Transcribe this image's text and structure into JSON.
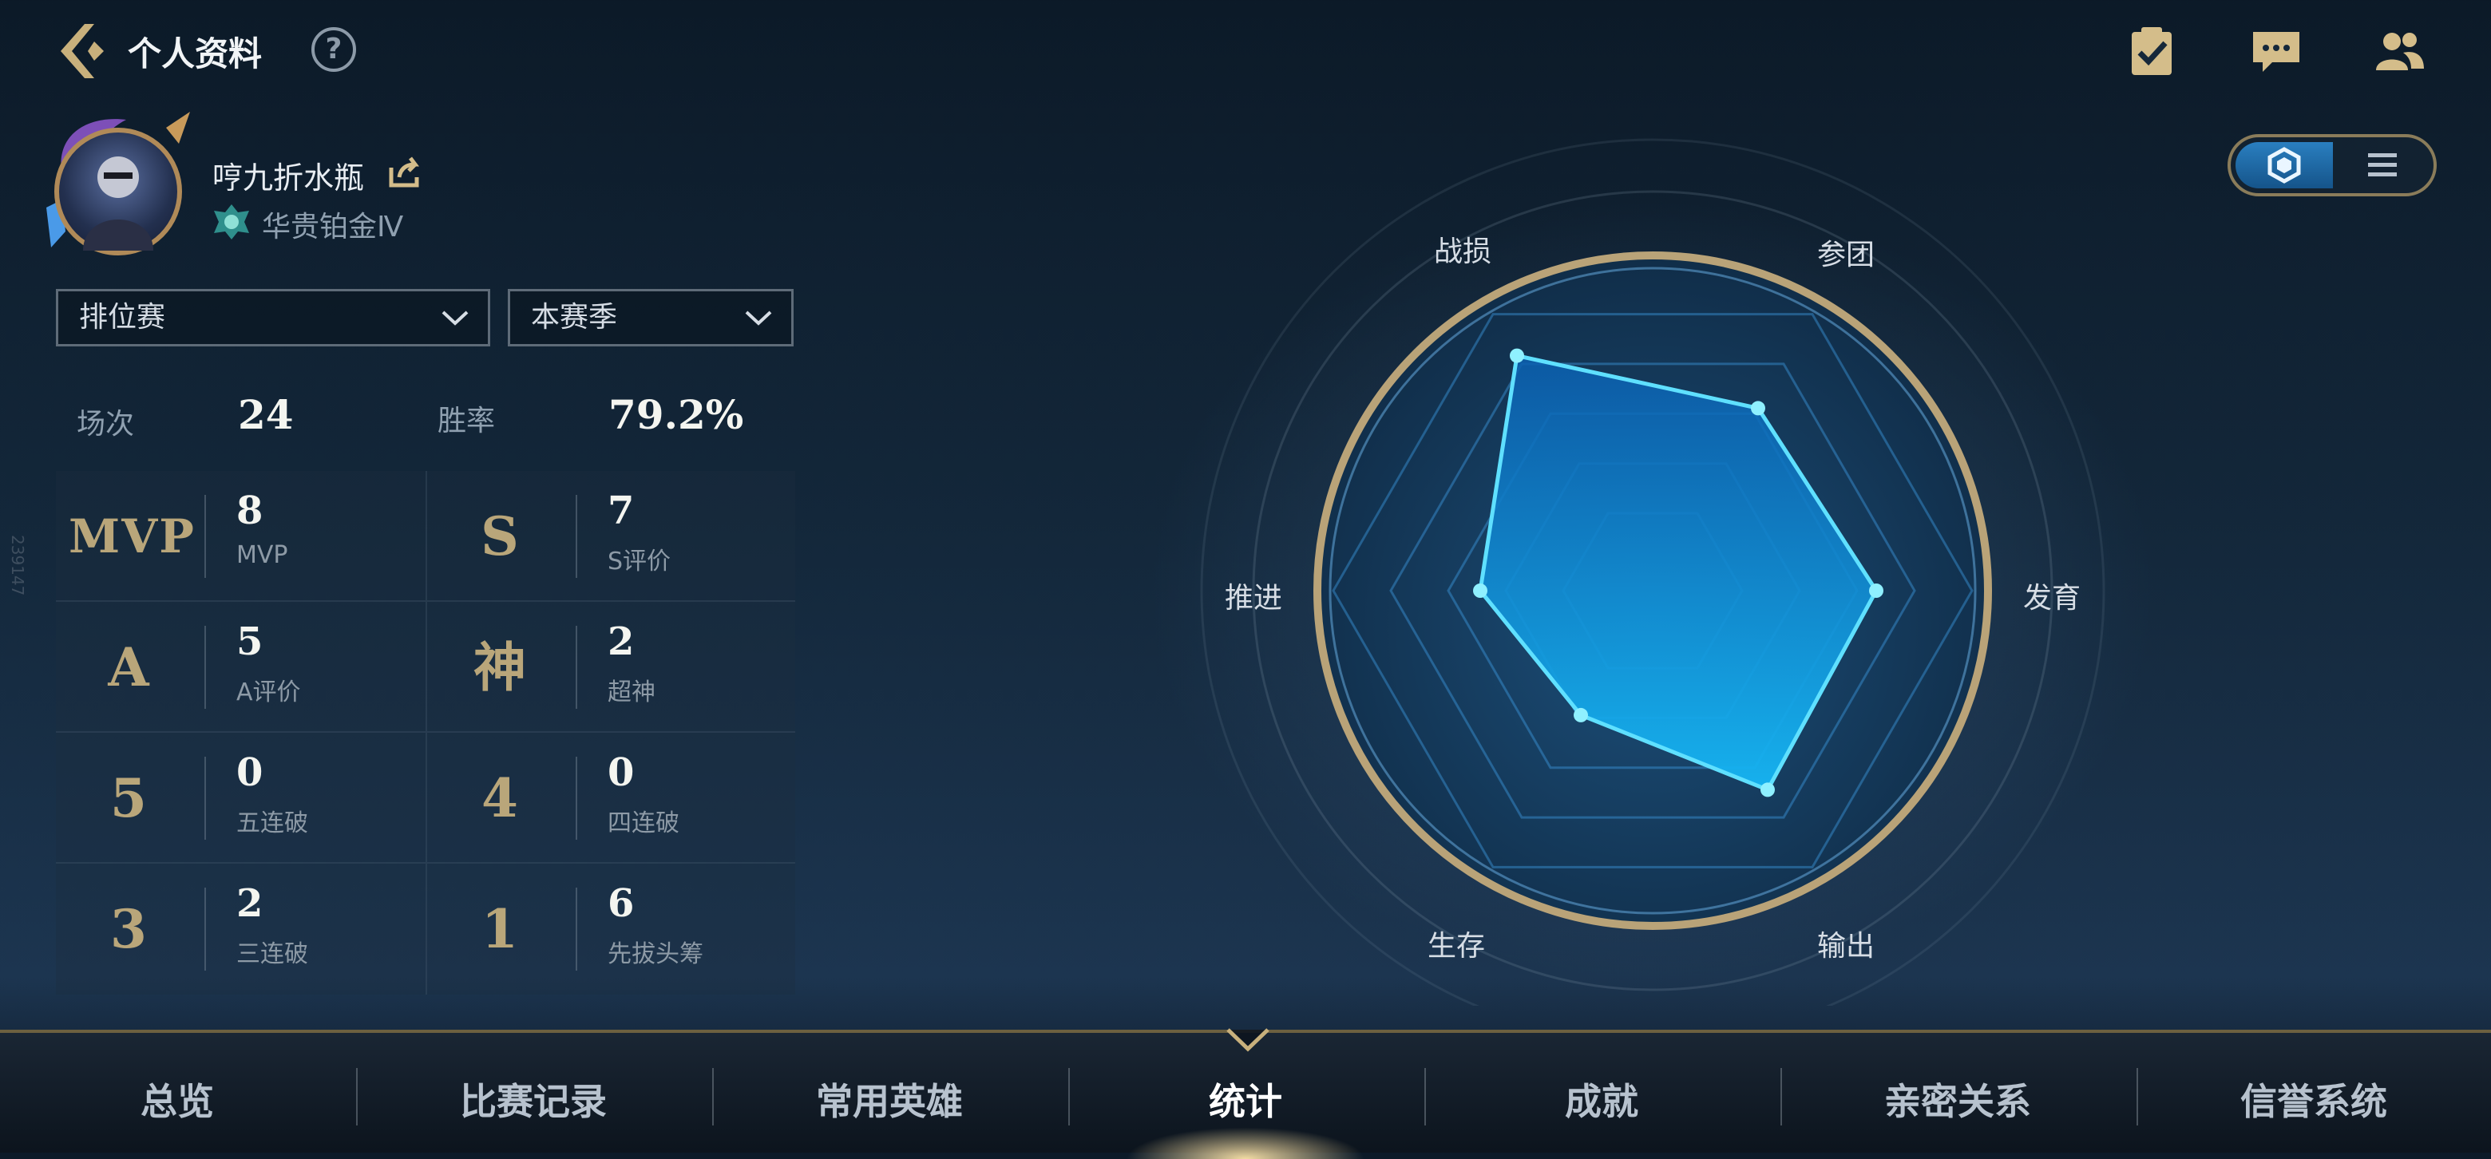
{
  "header": {
    "title": "个人资料",
    "help_glyph": "?",
    "icons": [
      "task-clipboard-icon",
      "message-icon",
      "friends-icon"
    ]
  },
  "profile": {
    "nickname": "哼九折水瓶",
    "rank": "华贵铂金Ⅳ"
  },
  "filters": {
    "mode": "排位赛",
    "season": "本赛季"
  },
  "summary": {
    "games_label": "场次",
    "games_value": "24",
    "winrate_label": "胜率",
    "winrate_value": "79.2%"
  },
  "stats": [
    {
      "badge": "MVP",
      "value": "8",
      "label": "MVP"
    },
    {
      "badge": "S",
      "value": "7",
      "label": "S评价"
    },
    {
      "badge": "A",
      "value": "5",
      "label": "A评价"
    },
    {
      "badge": "神",
      "value": "2",
      "label": "超神"
    },
    {
      "badge": "5",
      "value": "0",
      "label": "五连破"
    },
    {
      "badge": "4",
      "value": "0",
      "label": "四连破"
    },
    {
      "badge": "3",
      "value": "2",
      "label": "三连破"
    },
    {
      "badge": "1",
      "value": "6",
      "label": "先拔头筹"
    }
  ],
  "radar": {
    "axes": [
      "战损",
      "参团",
      "发育",
      "输出",
      "生存",
      "推进"
    ],
    "values": [
      0.85,
      0.66,
      0.7,
      0.72,
      0.45,
      0.54
    ]
  },
  "view_toggle": {
    "options": [
      "radar-icon",
      "list-icon"
    ],
    "selected": "radar-icon"
  },
  "bottom_nav": {
    "tabs": [
      "总览",
      "比赛记录",
      "常用英雄",
      "统计",
      "成就",
      "亲密关系",
      "信誉系统"
    ],
    "active": "统计"
  },
  "side_stamp": "239147",
  "colors": {
    "accent_gold": "#b9a67a",
    "radar_fill": "#1aa6f0",
    "radar_line": "#5fe0ff"
  }
}
